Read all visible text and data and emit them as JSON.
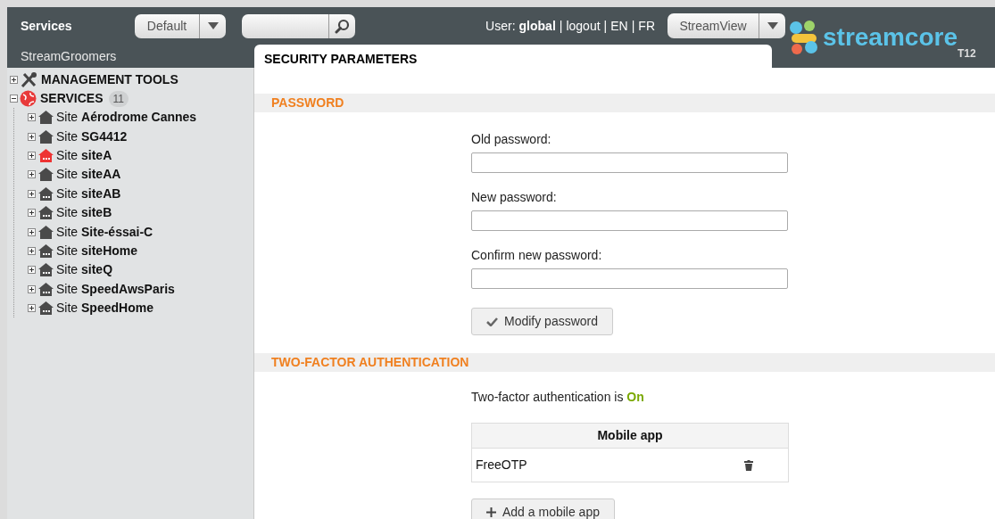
{
  "header": {
    "title": "Services",
    "subtitle": "StreamGroomers",
    "view_select": {
      "value": "Default"
    },
    "user_label": "User:",
    "user": "global",
    "links": [
      {
        "separator": "|",
        "label": "logout"
      },
      {
        "separator": "|",
        "label": "EN"
      },
      {
        "separator": "|",
        "label": "FR"
      }
    ],
    "app_select": {
      "value": "StreamView"
    },
    "logo": {
      "text": "streamcore",
      "suffix": "T12"
    }
  },
  "tab": {
    "label": "SECURITY PARAMETERS",
    "selected": true
  },
  "tree": [
    {
      "kind": "tools",
      "label": "MANAGEMENT TOOLS",
      "expanded": false
    },
    {
      "kind": "services",
      "label": "SERVICES",
      "count": "11",
      "expanded": true,
      "children": [
        {
          "prefix": "Site",
          "name": "Aérodrome Cannes",
          "color": "#4a4a4a",
          "kind": "plain"
        },
        {
          "prefix": "Site",
          "name": "SG4412",
          "color": "#4a4a4a",
          "kind": "plain"
        },
        {
          "prefix": "Site",
          "name": "siteA",
          "color": "#ee3333",
          "kind": "windows"
        },
        {
          "prefix": "Site",
          "name": "siteAA",
          "color": "#4a4a4a",
          "kind": "plain"
        },
        {
          "prefix": "Site",
          "name": "siteAB",
          "color": "#4a4a4a",
          "kind": "windows"
        },
        {
          "prefix": "Site",
          "name": "siteB",
          "color": "#4a4a4a",
          "kind": "windows"
        },
        {
          "prefix": "Site",
          "name": "Site-éssai-C",
          "color": "#4a4a4a",
          "kind": "plain"
        },
        {
          "prefix": "Site",
          "name": "siteHome",
          "color": "#4a4a4a",
          "kind": "windows"
        },
        {
          "prefix": "Site",
          "name": "siteQ",
          "color": "#4a4a4a",
          "kind": "windows"
        },
        {
          "prefix": "Site",
          "name": "SpeedAwsParis",
          "color": "#4a4a4a",
          "kind": "windows"
        },
        {
          "prefix": "Site",
          "name": "SpeedHome",
          "color": "#4a4a4a",
          "kind": "windows"
        }
      ]
    }
  ],
  "password": {
    "heading": "PASSWORD",
    "fields": [
      {
        "label": "Old password:"
      },
      {
        "label": "New password:"
      },
      {
        "label": "Confirm new password:"
      }
    ],
    "button": "Modify password"
  },
  "two_factor": {
    "heading": "TWO-FACTOR AUTHENTICATION",
    "status_text": "Two-factor authentication is",
    "status": "On",
    "on": true,
    "table": {
      "columns": [
        "Mobile app"
      ],
      "rows": [
        {
          "name": "FreeOTP"
        }
      ]
    },
    "button": "Add a mobile app"
  }
}
